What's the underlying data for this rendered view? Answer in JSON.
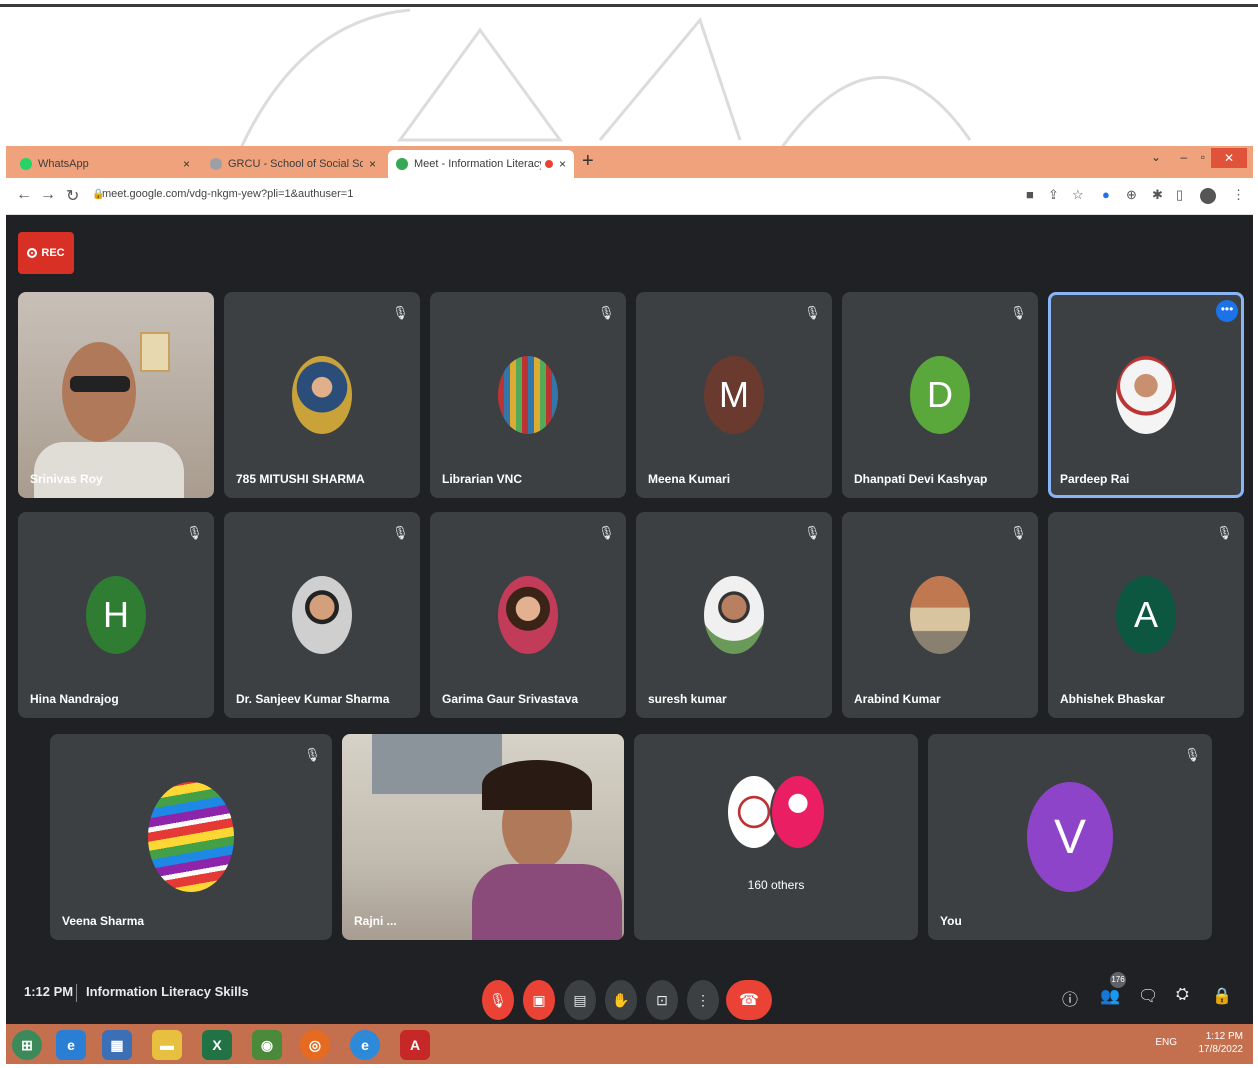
{
  "browser": {
    "tabs": [
      {
        "label": "WhatsApp",
        "close": "×",
        "color": "#25d366"
      },
      {
        "label": "GRCU - School of Social Scien",
        "close": "×",
        "color": "#9aa0a6"
      },
      {
        "label": "Meet - Information Literacy",
        "close": "×",
        "color": "#34a853"
      }
    ],
    "new_tab": "+",
    "url": "meet.google.com/vdg-nkgm-yew?pli=1&authuser=1",
    "win_min": "–",
    "win_max": "▫",
    "win_close": "✕"
  },
  "rec_label": "REC",
  "tiles": [
    {
      "name": "Srinivas Roy",
      "kind": "video"
    },
    {
      "name": "785 MITUSHI SHARMA",
      "kind": "photo"
    },
    {
      "name": "Librarian VNC",
      "kind": "photo"
    },
    {
      "name": "Meena Kumari",
      "kind": "letter",
      "letter": "M",
      "color": "#6b3a2e"
    },
    {
      "name": "Dhanpati Devi Kashyap",
      "kind": "letter",
      "letter": "D",
      "color": "#5aa83c"
    },
    {
      "name": "Pardeep Rai",
      "kind": "photo",
      "more": "•••"
    },
    {
      "name": "Hina Nandrajog",
      "kind": "letter",
      "letter": "H",
      "color": "#2e7d32"
    },
    {
      "name": "Dr. Sanjeev Kumar Sharma",
      "kind": "photo"
    },
    {
      "name": "Garima Gaur Srivastava",
      "kind": "photo"
    },
    {
      "name": "suresh kumar",
      "kind": "photo"
    },
    {
      "name": "Arabind Kumar",
      "kind": "photo"
    },
    {
      "name": "Abhishek Bhaskar",
      "kind": "letter",
      "letter": "A",
      "color": "#0d5740"
    },
    {
      "name": "Veena Sharma",
      "kind": "photo"
    },
    {
      "name": "Rajni ...",
      "kind": "video"
    },
    {
      "name": "160 others",
      "kind": "others"
    },
    {
      "name": "You",
      "kind": "letter",
      "letter": "V",
      "color": "#8e44c9"
    }
  ],
  "bottom": {
    "time": "1:12 PM",
    "meeting_title": "Information Literacy Skills",
    "participants_count": "176"
  },
  "taskbar": {
    "tray_time": "1:12 PM",
    "tray_date": "17/8/2022",
    "tray_lang": "ENG"
  },
  "colors": {
    "meet_bg": "#202124",
    "tile_bg": "#3c4043",
    "danger": "#ea4335",
    "accent": "#1a73e8"
  }
}
